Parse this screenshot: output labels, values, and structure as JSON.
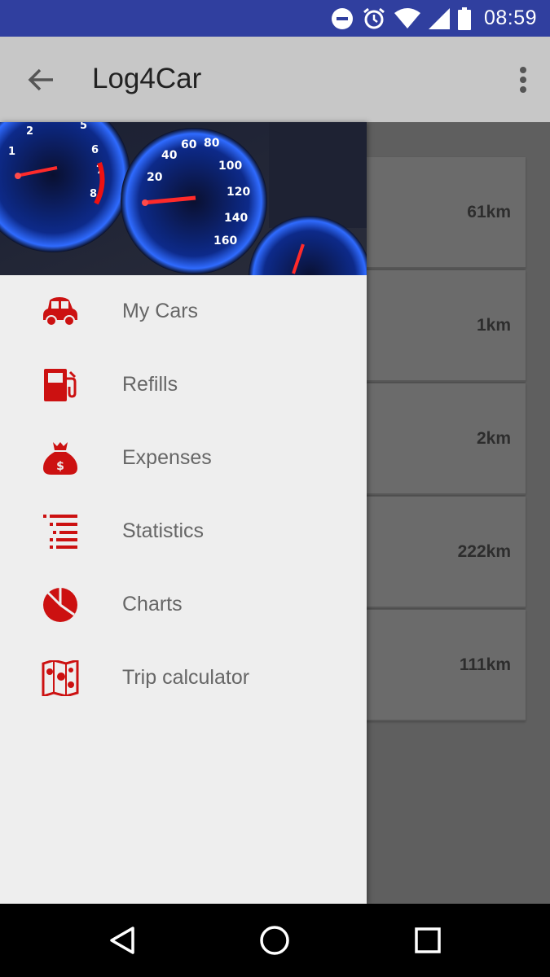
{
  "status_bar": {
    "time": "08:59",
    "icons": [
      "do-not-disturb-icon",
      "alarm-icon",
      "wifi-icon",
      "signal-icon",
      "battery-icon"
    ]
  },
  "app_bar": {
    "title": "Log4Car",
    "back_icon": "arrow-back-icon",
    "overflow_icon": "more-vert-icon"
  },
  "background_list": {
    "items": [
      {
        "distance": "61km"
      },
      {
        "distance": "1km"
      },
      {
        "distance": "2km"
      },
      {
        "distance": "222km"
      },
      {
        "distance": "111km"
      }
    ]
  },
  "drawer": {
    "header_image": "car-dashboard-gauges",
    "items": [
      {
        "label": "My Cars",
        "icon": "car-icon"
      },
      {
        "label": "Refills",
        "icon": "fuel-pump-icon"
      },
      {
        "label": "Expenses",
        "icon": "money-bag-icon"
      },
      {
        "label": "Statistics",
        "icon": "list-icon"
      },
      {
        "label": "Charts",
        "icon": "pie-chart-icon"
      },
      {
        "label": "Trip calculator",
        "icon": "map-icon"
      }
    ]
  },
  "nav_bar": {
    "icons": [
      "back-triangle-icon",
      "home-circle-icon",
      "recents-square-icon"
    ]
  },
  "colors": {
    "status_bar": "#303f9f",
    "app_bar": "#c7c7c7",
    "accent_red": "#cc1111",
    "drawer_bg": "#eeeeee",
    "scrim": "#606060"
  }
}
